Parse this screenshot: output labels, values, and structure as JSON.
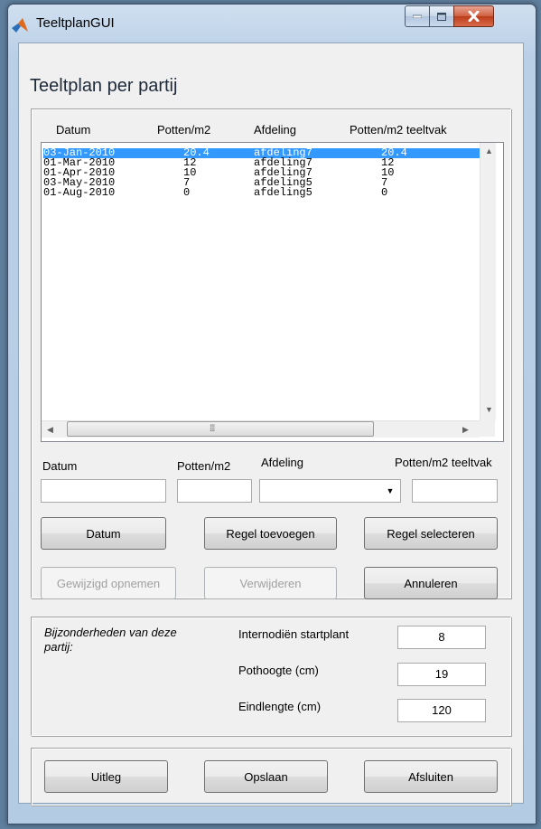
{
  "window": {
    "title": "TeeltplanGUI"
  },
  "page": {
    "title": "Teeltplan per partij"
  },
  "list": {
    "headers": [
      "Datum",
      "Potten/m2",
      "Afdeling",
      "Potten/m2 teeltvak"
    ],
    "rows": [
      [
        "03-Jan-2010",
        "20.4",
        "afdeling7",
        "20.4"
      ],
      [
        "01-Mar-2010",
        "12",
        "afdeling7",
        "12"
      ],
      [
        "01-Apr-2010",
        "10",
        "afdeling7",
        "10"
      ],
      [
        "03-May-2010",
        "7",
        "afdeling5",
        "7"
      ],
      [
        "01-Aug-2010",
        "0",
        "afdeling5",
        "0"
      ]
    ],
    "selected_row": 0
  },
  "editor": {
    "labels": {
      "datum": "Datum",
      "potten": "Potten/m2",
      "afdeling": "Afdeling",
      "potten_teeltvak": "Potten/m2 teeltvak"
    },
    "values": {
      "datum": "",
      "potten": "",
      "afdeling": "",
      "potten_teeltvak": ""
    }
  },
  "buttons": {
    "datum": "Datum",
    "regel_toevoegen": "Regel toevoegen",
    "regel_selecteren": "Regel selecteren",
    "gewijzigd_opnemen": "Gewijzigd opnemen",
    "verwijderen": "Verwijderen",
    "annuleren": "Annuleren"
  },
  "details": {
    "caption": "Bijzonderheden van deze partij:",
    "fields": [
      {
        "label": "Internodiën startplant",
        "value": "8"
      },
      {
        "label": "Pothoogte (cm)",
        "value": "19"
      },
      {
        "label": "Eindlengte (cm)",
        "value": "120"
      }
    ]
  },
  "footer": {
    "uitleg": "Uitleg",
    "opslaan": "Opslaan",
    "afsluiten": "Afsluiten"
  },
  "colors": {
    "selection": "#3399ff",
    "row_text": "#000000",
    "disabled_text": "#a0a0a0"
  }
}
